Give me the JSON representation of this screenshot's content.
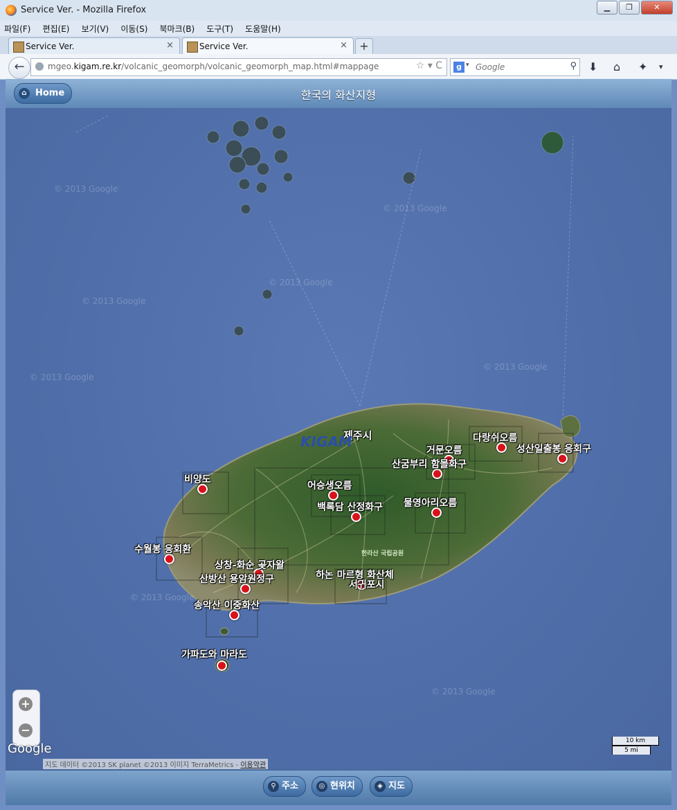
{
  "window": {
    "title": "Service Ver. - Mozilla Firefox",
    "min": "▁",
    "max": "❐",
    "close": "✕"
  },
  "menu": [
    "파일(F)",
    "편집(E)",
    "보기(V)",
    "이동(S)",
    "북마크(B)",
    "도구(T)",
    "도움말(H)"
  ],
  "tabs": [
    {
      "label": "Service Ver."
    },
    {
      "label": "Service Ver."
    }
  ],
  "tab_close": "×",
  "new_tab": "+",
  "nav": {
    "url_host": "mgeo.",
    "url_domain": "kigam.re.kr",
    "url_path": "/volcanic_geomorph/volcanic_geomorph_map.html#mappage",
    "url_icons": "☆ ▾ C",
    "search_placeholder": "Google"
  },
  "app": {
    "home_label": "Home",
    "title": "한국의 화산지형"
  },
  "map": {
    "places": [
      {
        "name": "다랑쉬오름"
      },
      {
        "name": "거문오름"
      },
      {
        "name": "성산일출봉 응회구"
      },
      {
        "name": "산굼부리 함몰화구"
      },
      {
        "name": "비양도"
      },
      {
        "name": "어승생오름"
      },
      {
        "name": "백록담 산정화구"
      },
      {
        "name": "물영아리오름"
      },
      {
        "name": "수월봉 응회환"
      },
      {
        "name": "상창-화순 곶자왈"
      },
      {
        "name": "산방산 용암원정구"
      },
      {
        "name": "하논 마르형 화산체"
      },
      {
        "name": "서귀포시"
      },
      {
        "name": "송악산 이중화산"
      },
      {
        "name": "가파도와 마라도"
      }
    ],
    "city_label": "제주시",
    "park_label": "한라산 국립공원",
    "kigam_logo": "KIGAM",
    "watermark": "© 2013 Google",
    "google_logo": "Google",
    "attribution": "지도 데이터 ©2013 SK planet ©2013 이미지 TerraMetrics -",
    "attribution_link": "이용약관",
    "scale_km": "10 km",
    "scale_mi": "5 mi",
    "zoom_in": "+",
    "zoom_out": "−"
  },
  "footer": {
    "address": "주소",
    "location": "현위치",
    "map": "지도"
  }
}
